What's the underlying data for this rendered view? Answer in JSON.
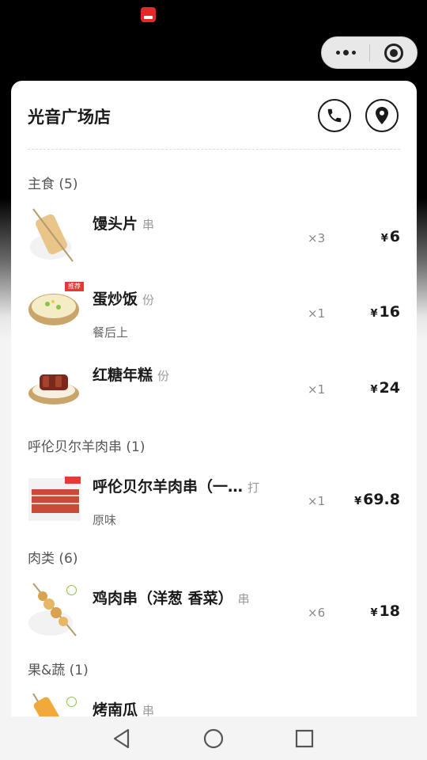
{
  "store": {
    "name": "光音广场店"
  },
  "sections": [
    {
      "title": "主食 (5)"
    },
    {
      "title": "呼伦贝尔羊肉串 (1)"
    },
    {
      "title": "肉类 (6)"
    },
    {
      "title": "果&蔬 (1)"
    }
  ],
  "items": [
    {
      "name": "馒头片",
      "unit": "串",
      "note": "",
      "qty": "×3",
      "currency": "¥",
      "price": "6"
    },
    {
      "name": "蛋炒饭",
      "unit": "份",
      "note": "餐后上",
      "qty": "×1",
      "currency": "¥",
      "price": "16"
    },
    {
      "name": "红糖年糕",
      "unit": "份",
      "note": "",
      "qty": "×1",
      "currency": "¥",
      "price": "24"
    },
    {
      "name": "呼伦贝尔羊肉串（一…",
      "unit": "打",
      "note": "原味",
      "qty": "×1",
      "currency": "¥",
      "price": "69.8"
    },
    {
      "name": "鸡肉串（洋葱 香菜）",
      "unit": "串",
      "note": "",
      "qty": "×6",
      "currency": "¥",
      "price": "18"
    },
    {
      "name": "烤南瓜",
      "unit": "串",
      "note": "",
      "qty": "",
      "currency": "",
      "price": ""
    }
  ],
  "badges": {
    "recommend": "推荐"
  },
  "icons": {
    "phone": "phone-icon",
    "location": "location-pin-icon",
    "more": "more-dots-icon",
    "close": "target-close-icon",
    "back": "back-triangle-icon",
    "home": "home-circle-icon",
    "recent": "recent-square-icon"
  }
}
